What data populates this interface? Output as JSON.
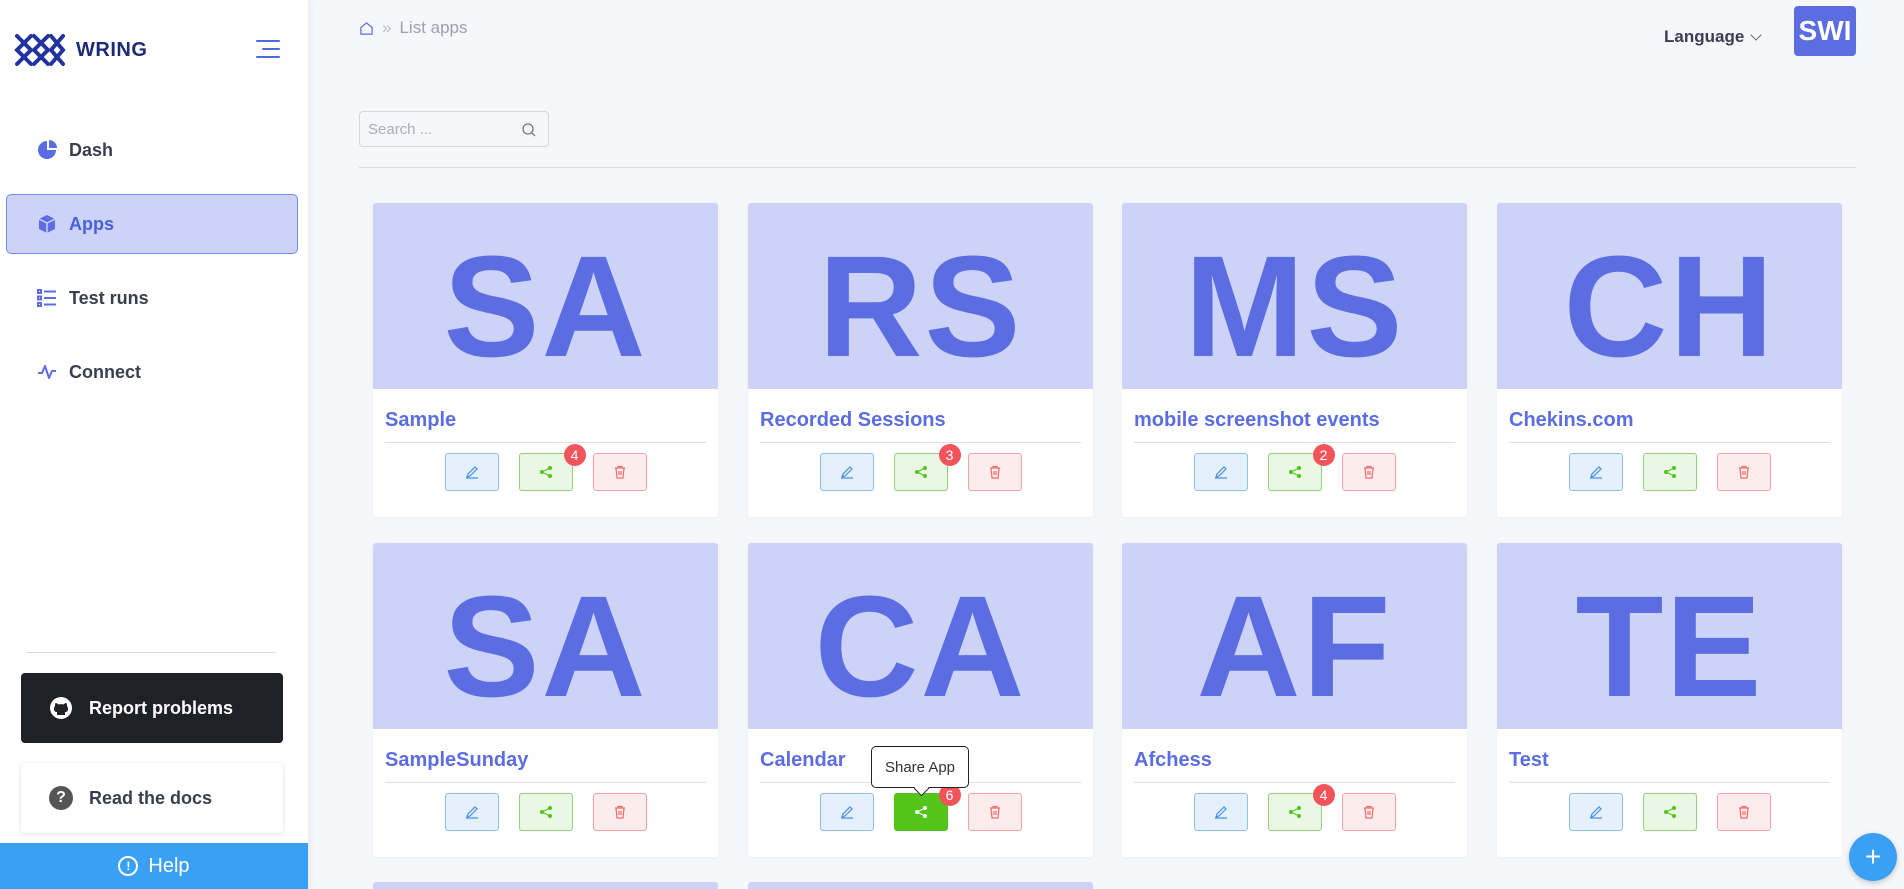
{
  "brand": {
    "name": "WRING",
    "logo_icon": "wring-logo-icon",
    "color": "#1c2b78"
  },
  "sidebar": {
    "items": [
      {
        "label": "Dash",
        "icon": "pie-chart-icon",
        "active": false
      },
      {
        "label": "Apps",
        "icon": "cube-icon",
        "active": true
      },
      {
        "label": "Test runs",
        "icon": "list-icon",
        "active": false
      },
      {
        "label": "Connect",
        "icon": "activity-icon",
        "active": false
      }
    ],
    "report_label": "Report problems",
    "docs_label": "Read the docs",
    "help_label": "Help"
  },
  "header": {
    "breadcrumb": [
      "List apps"
    ],
    "language_label": "Language",
    "avatar_text": "SWI"
  },
  "search": {
    "placeholder": "Search ..."
  },
  "apps": [
    {
      "initials": "SA",
      "name": "Sample",
      "share_count": "4"
    },
    {
      "initials": "RS",
      "name": "Recorded Sessions",
      "share_count": "3"
    },
    {
      "initials": "MS",
      "name": "mobile screenshot events",
      "share_count": "2"
    },
    {
      "initials": "CH",
      "name": "Chekins.com",
      "share_count": ""
    },
    {
      "initials": "SA",
      "name": "SampleSunday",
      "share_count": ""
    },
    {
      "initials": "CA",
      "name": "Calendar",
      "share_count": "6"
    },
    {
      "initials": "AF",
      "name": "Afchess",
      "share_count": "4"
    },
    {
      "initials": "TE",
      "name": "Test",
      "share_count": ""
    }
  ],
  "tooltip": {
    "text": "Share App"
  },
  "colors": {
    "accent": "#5b6de0",
    "card_header": "#ccd3f7",
    "help": "#3aa0f4",
    "badge": "#f1545a",
    "share": "#52c41a"
  }
}
